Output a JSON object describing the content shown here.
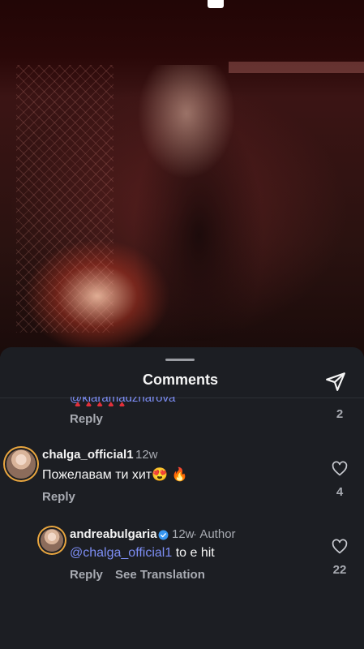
{
  "sheet": {
    "title": "Comments"
  },
  "cutoff_comment": {
    "text": "@klaramadzharova",
    "hearts": "♦♦♦♦♦",
    "reply_label": "Reply",
    "like_count": "2"
  },
  "comment1": {
    "username": "chalga_official1",
    "time": "12w",
    "text": "Пожелавам ти хит😍 🔥",
    "reply_label": "Reply",
    "like_count": "4"
  },
  "comment2": {
    "username": "andreabulgaria",
    "time": "12w",
    "author_label": "· Author",
    "mention": "@chalga_official1",
    "text": " to e hit",
    "reply_label": "Reply",
    "translate_label": "See Translation",
    "like_count": "22"
  },
  "colors": {
    "mention": "#7d8ef5",
    "verified": "#3797f0",
    "background": "#1c1e23"
  },
  "icons": [
    "share-icon",
    "heart-outline-icon",
    "verified-icon"
  ]
}
